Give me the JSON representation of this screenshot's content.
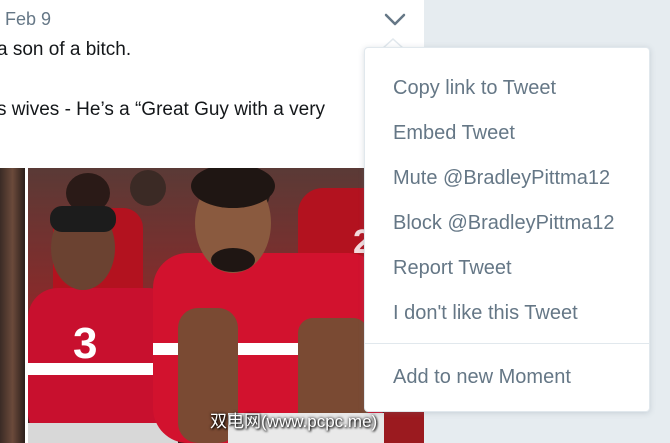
{
  "tweet": {
    "date": "Feb 9",
    "line1": "a son of a bitch.",
    "line2": "s wives - He’s a “Great Guy with a very"
  },
  "watermark": "双电网(www.pcpc.me)",
  "menu": {
    "items": [
      "Copy link to Tweet",
      "Embed Tweet",
      "Mute @BradleyPittma12",
      "Block @BradleyPittma12",
      "Report Tweet",
      "I don't like this Tweet"
    ],
    "moment_item": "Add to new Moment"
  },
  "colors": {
    "jersey_red": "#c8102e",
    "menu_text": "#657786",
    "background": "#e6ecf0"
  },
  "icons": {
    "menu_toggle": "chevron-down-icon"
  }
}
